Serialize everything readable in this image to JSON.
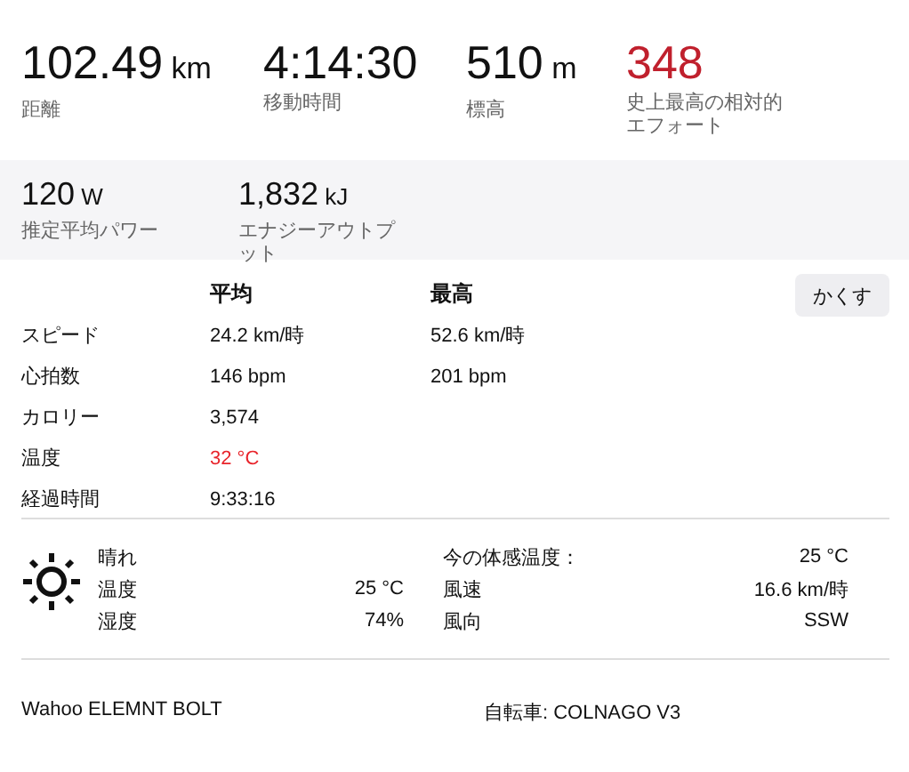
{
  "primary_stats": [
    {
      "value": "102.49",
      "unit": "km",
      "label": "距離",
      "emphasis": false
    },
    {
      "value": "4:14:30",
      "label": "移動時間",
      "emphasis": false
    },
    {
      "value": "510",
      "unit": "m",
      "label": "標高",
      "emphasis": false
    },
    {
      "value": "348",
      "label": "史上最高の相対的エフォート",
      "emphasis": true
    }
  ],
  "secondary_stats": [
    {
      "value": "120",
      "unit": "W",
      "label": "推定平均パワー"
    },
    {
      "value": "1,832",
      "unit": "kJ",
      "label": "エナジーアウトプット"
    }
  ],
  "details": {
    "columns": [
      "平均",
      "最高"
    ],
    "hide_button": "かくす",
    "rows": [
      {
        "label": "スピード",
        "avg": "24.2 km/時",
        "max": "52.6 km/時",
        "alert": false
      },
      {
        "label": "心拍数",
        "avg": "146 bpm",
        "max": "201 bpm",
        "alert": false
      },
      {
        "label": "カロリー",
        "avg": "3,574",
        "alert": false
      },
      {
        "label": "温度",
        "avg": "32 °C",
        "alert": true
      },
      {
        "label": "経過時間",
        "avg": "9:33:16",
        "alert": false
      }
    ]
  },
  "weather": {
    "condition": "晴れ",
    "left": [
      {
        "label": "温度",
        "value": "25 °C"
      },
      {
        "label": "湿度",
        "value": "74%"
      }
    ],
    "right": [
      {
        "label": "今の体感温度：",
        "value": "25 °C"
      },
      {
        "label": "風速",
        "value": "16.6 km/時"
      },
      {
        "label": "風向",
        "value": "SSW"
      }
    ]
  },
  "footer": {
    "device": "Wahoo ELEMNT BOLT",
    "bike": "自転車: COLNAGO V3"
  }
}
